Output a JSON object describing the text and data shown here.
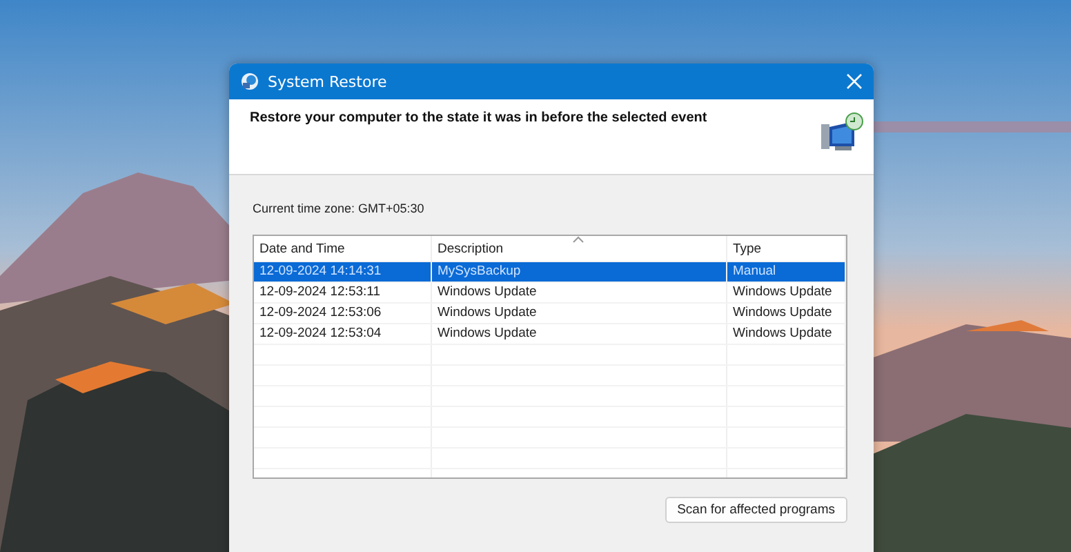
{
  "window": {
    "title": "System Restore"
  },
  "header": {
    "text": "Restore your computer to the state it was in before the selected event"
  },
  "time_zone": "Current time zone: GMT+05:30",
  "table": {
    "columns": [
      "Date and Time",
      "Description",
      "Type"
    ],
    "rows": [
      {
        "cells": [
          "12-09-2024 14:14:31",
          "MySysBackup",
          "Manual"
        ],
        "selected": true
      },
      {
        "cells": [
          "12-09-2024 12:53:11",
          "Windows Update",
          "Windows Update"
        ],
        "selected": false
      },
      {
        "cells": [
          "12-09-2024 12:53:06",
          "Windows Update",
          "Windows Update"
        ],
        "selected": false
      },
      {
        "cells": [
          "12-09-2024 12:53:04",
          "Windows Update",
          "Windows Update"
        ],
        "selected": false
      }
    ]
  },
  "buttons": [
    "Scan for affected programs"
  ]
}
